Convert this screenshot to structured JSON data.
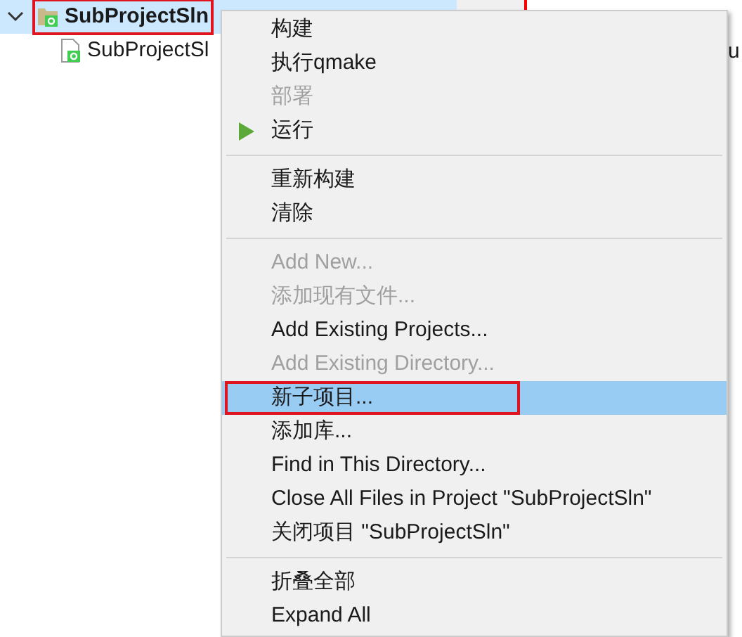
{
  "tree": [
    {
      "label": "SubProjectSln",
      "expanded": true,
      "selected": true,
      "outlined": true,
      "children": [
        {
          "label": "SubProjectSl",
          "selected": false,
          "outlined": false
        }
      ]
    }
  ],
  "right_panel": {
    "partial_text": "u"
  },
  "context_menu": [
    {
      "kind": "item",
      "label": "构建",
      "disabled": false,
      "selected": false,
      "outlined": false
    },
    {
      "kind": "item",
      "label": "执行qmake",
      "disabled": false,
      "selected": false,
      "outlined": false
    },
    {
      "kind": "item",
      "label": "部署",
      "disabled": true,
      "selected": false,
      "outlined": false
    },
    {
      "kind": "run",
      "label": "运行",
      "disabled": false,
      "selected": false,
      "outlined": false
    },
    {
      "kind": "separator"
    },
    {
      "kind": "item",
      "label": "重新构建",
      "disabled": false,
      "selected": false,
      "outlined": false
    },
    {
      "kind": "item",
      "label": "清除",
      "disabled": false,
      "selected": false,
      "outlined": false
    },
    {
      "kind": "separator"
    },
    {
      "kind": "item",
      "label": "Add New...",
      "disabled": true,
      "selected": false,
      "outlined": false
    },
    {
      "kind": "item",
      "label": "添加现有文件...",
      "disabled": true,
      "selected": false,
      "outlined": false
    },
    {
      "kind": "item",
      "label": "Add Existing Projects...",
      "disabled": false,
      "selected": false,
      "outlined": false
    },
    {
      "kind": "item",
      "label": "Add Existing Directory...",
      "disabled": true,
      "selected": false,
      "outlined": false
    },
    {
      "kind": "item",
      "label": "新子项目...",
      "disabled": false,
      "selected": true,
      "outlined": true
    },
    {
      "kind": "item",
      "label": "添加库...",
      "disabled": false,
      "selected": false,
      "outlined": false
    },
    {
      "kind": "item",
      "label": "Find in This Directory...",
      "disabled": false,
      "selected": false,
      "outlined": false
    },
    {
      "kind": "item",
      "label": "Close All Files in Project \"SubProjectSln\"",
      "disabled": false,
      "selected": false,
      "outlined": false
    },
    {
      "kind": "item",
      "label": "关闭项目 \"SubProjectSln\"",
      "disabled": false,
      "selected": false,
      "outlined": false
    },
    {
      "kind": "separator"
    },
    {
      "kind": "item",
      "label": "折叠全部",
      "disabled": false,
      "selected": false,
      "outlined": false
    },
    {
      "kind": "item",
      "label": "Expand All",
      "disabled": false,
      "selected": false,
      "outlined": false
    }
  ]
}
